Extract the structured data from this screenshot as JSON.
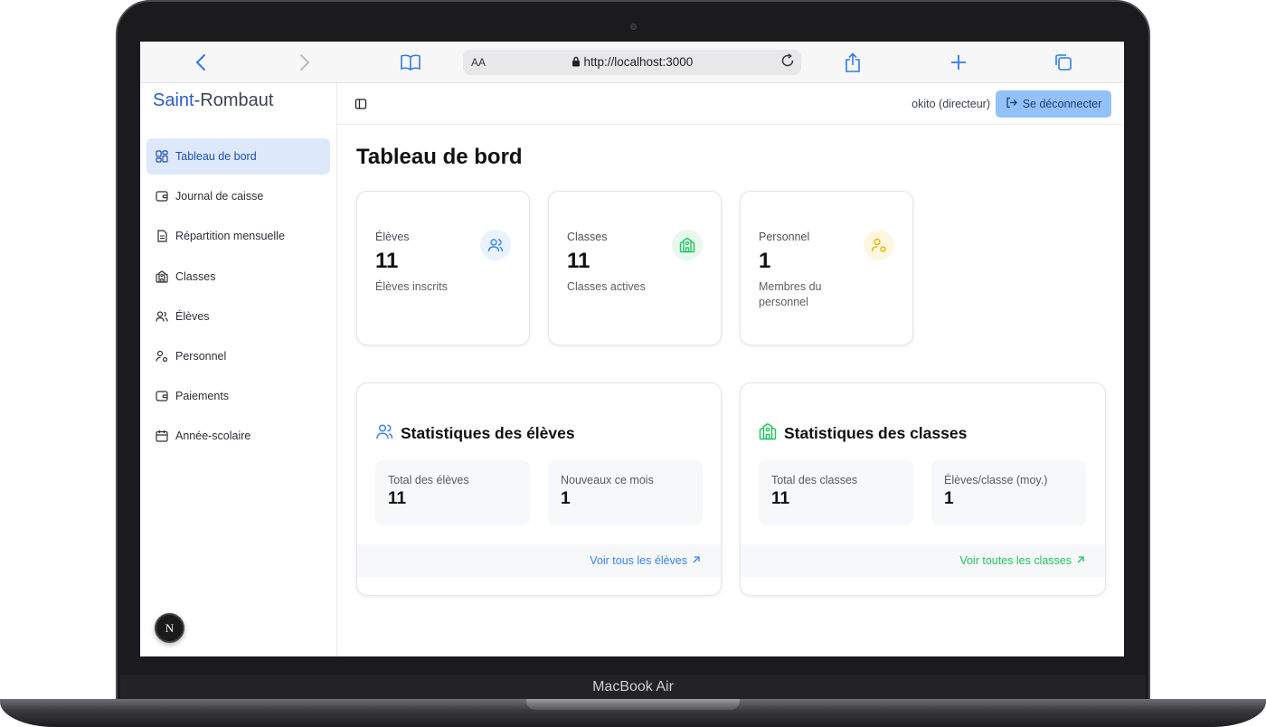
{
  "device": {
    "label": "MacBook Air"
  },
  "browser": {
    "url": "http://localhost:3000",
    "text_size_label": "AA",
    "icons": [
      "chevron-left-icon",
      "chevron-right-icon",
      "book-icon",
      "lock-icon",
      "reload-icon",
      "share-icon",
      "plus-icon",
      "tabs-icon"
    ]
  },
  "app": {
    "brand_part1": "Saint",
    "brand_part2": "-Rombaut",
    "user_label": "okito (directeur)",
    "logout_label": "Se déconnecter"
  },
  "sidebar": {
    "items": [
      {
        "label": "Tableau de bord",
        "icon": "dashboard-icon",
        "active": true
      },
      {
        "label": "Journal de caisse",
        "icon": "wallet-icon",
        "active": false
      },
      {
        "label": "Répartition mensuelle",
        "icon": "file-icon",
        "active": false
      },
      {
        "label": "Classes",
        "icon": "school-icon",
        "active": false
      },
      {
        "label": "Élèves",
        "icon": "users-icon",
        "active": false
      },
      {
        "label": "Personnel",
        "icon": "user-cog-icon",
        "active": false
      },
      {
        "label": "Paiements",
        "icon": "wallet-icon",
        "active": false
      },
      {
        "label": "Année-scolaire",
        "icon": "calendar-icon",
        "active": false
      }
    ],
    "badge": "N"
  },
  "main": {
    "title": "Tableau de bord",
    "stats": [
      {
        "label": "Élèves",
        "value": "11",
        "sub": "Élèves inscrits",
        "icon": "users-icon",
        "color": "#3b82f6"
      },
      {
        "label": "Classes",
        "value": "11",
        "sub": "Classes actives",
        "icon": "school-icon",
        "color": "#22c55e"
      },
      {
        "label": "Personnel",
        "value": "1",
        "sub": "Membres du personnel",
        "icon": "user-cog-icon",
        "color": "#eab308"
      }
    ],
    "sections": [
      {
        "title": "Statistiques des élèves",
        "icon": "users-icon",
        "color": "#3b82f6",
        "metrics": [
          {
            "label": "Total des élèves",
            "value": "11"
          },
          {
            "label": "Nouveaux ce mois",
            "value": "1"
          }
        ],
        "link": "Voir tous les élèves"
      },
      {
        "title": "Statistiques des classes",
        "icon": "school-icon",
        "color": "#22c55e",
        "metrics": [
          {
            "label": "Total des classes",
            "value": "11"
          },
          {
            "label": "Élèves/classe (moy.)",
            "value": "1"
          }
        ],
        "link": "Voir toutes les classes"
      }
    ]
  }
}
